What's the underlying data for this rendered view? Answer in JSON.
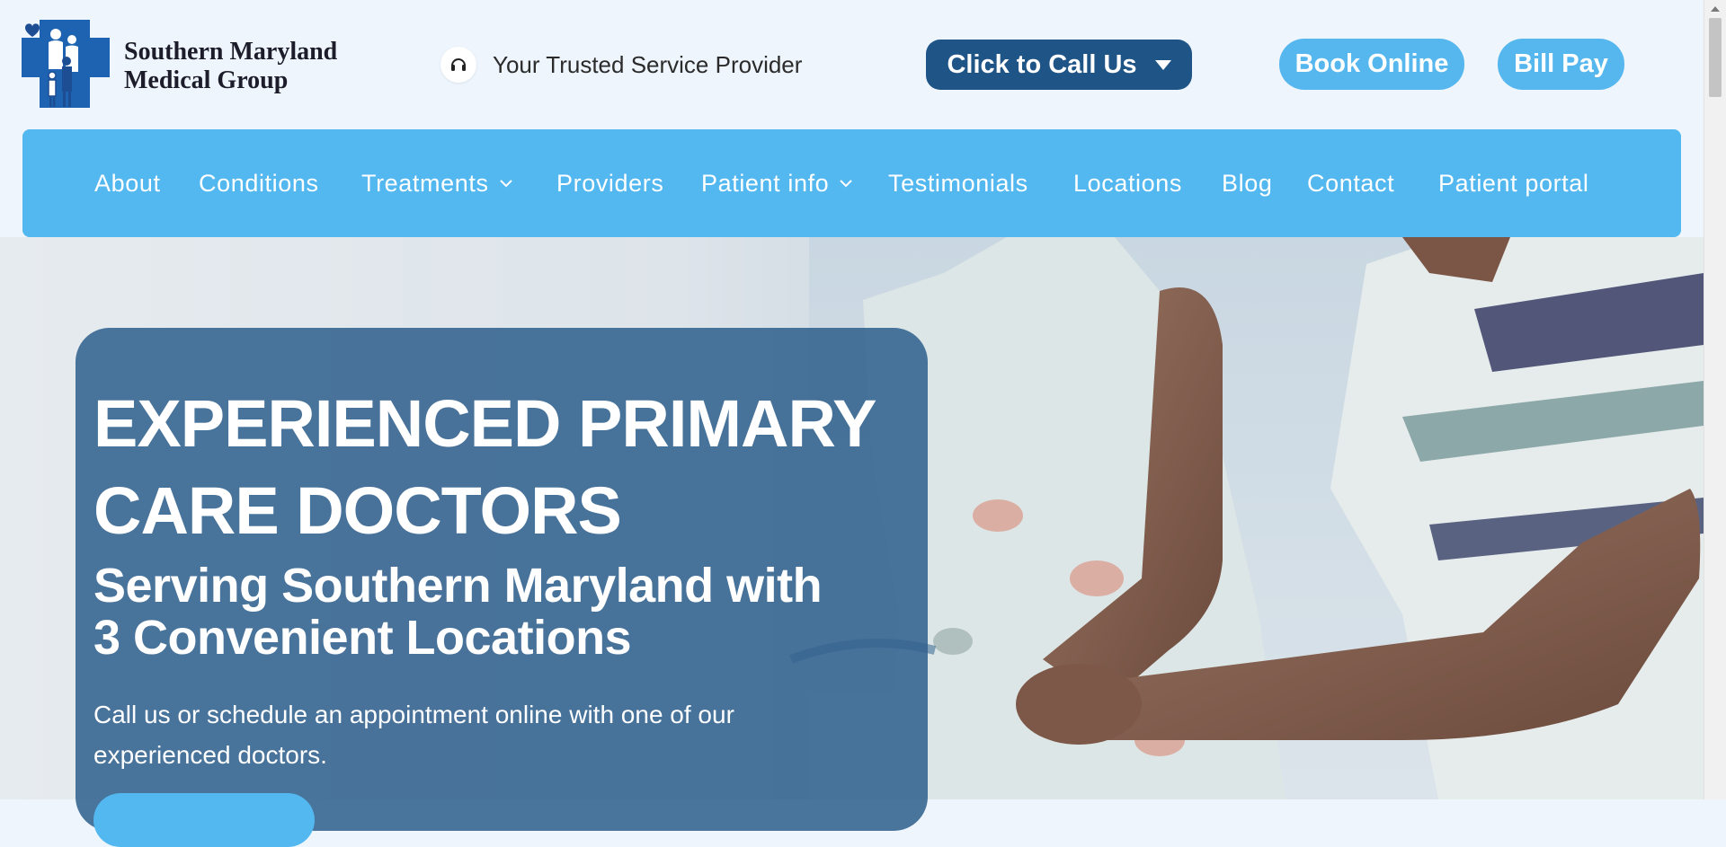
{
  "header": {
    "logo_line1": "Southern Maryland",
    "logo_line2": "Medical Group",
    "tagline": "Your Trusted Service Provider",
    "call_button": "Click to Call Us",
    "book_button": "Book Online",
    "bill_button": "Bill Pay"
  },
  "nav": {
    "items": [
      {
        "label": "About"
      },
      {
        "label": "Conditions"
      },
      {
        "label": "Treatments"
      },
      {
        "label": "Providers"
      },
      {
        "label": "Patient info"
      },
      {
        "label": "Testimonials"
      },
      {
        "label": "Locations"
      },
      {
        "label": "Blog"
      },
      {
        "label": "Contact"
      },
      {
        "label": "Patient portal"
      }
    ]
  },
  "hero": {
    "title_line1": "EXPERIENCED PRIMARY",
    "title_line2": "CARE DOCTORS",
    "subtitle_line1": "Serving Southern Maryland with",
    "subtitle_line2": "3 Convenient Locations",
    "body_line1": "Call us or schedule an appointment online with one of our",
    "body_line2": "experienced doctors."
  },
  "icons": {
    "headset": "headset-icon",
    "dropdown": "caret-down-icon",
    "chevron": "chevron-down-icon"
  },
  "colors": {
    "navy_button": "#1f5487",
    "light_blue": "#53b7f0",
    "hero_card": "#32628e",
    "page_bg": "#eef5fd"
  }
}
